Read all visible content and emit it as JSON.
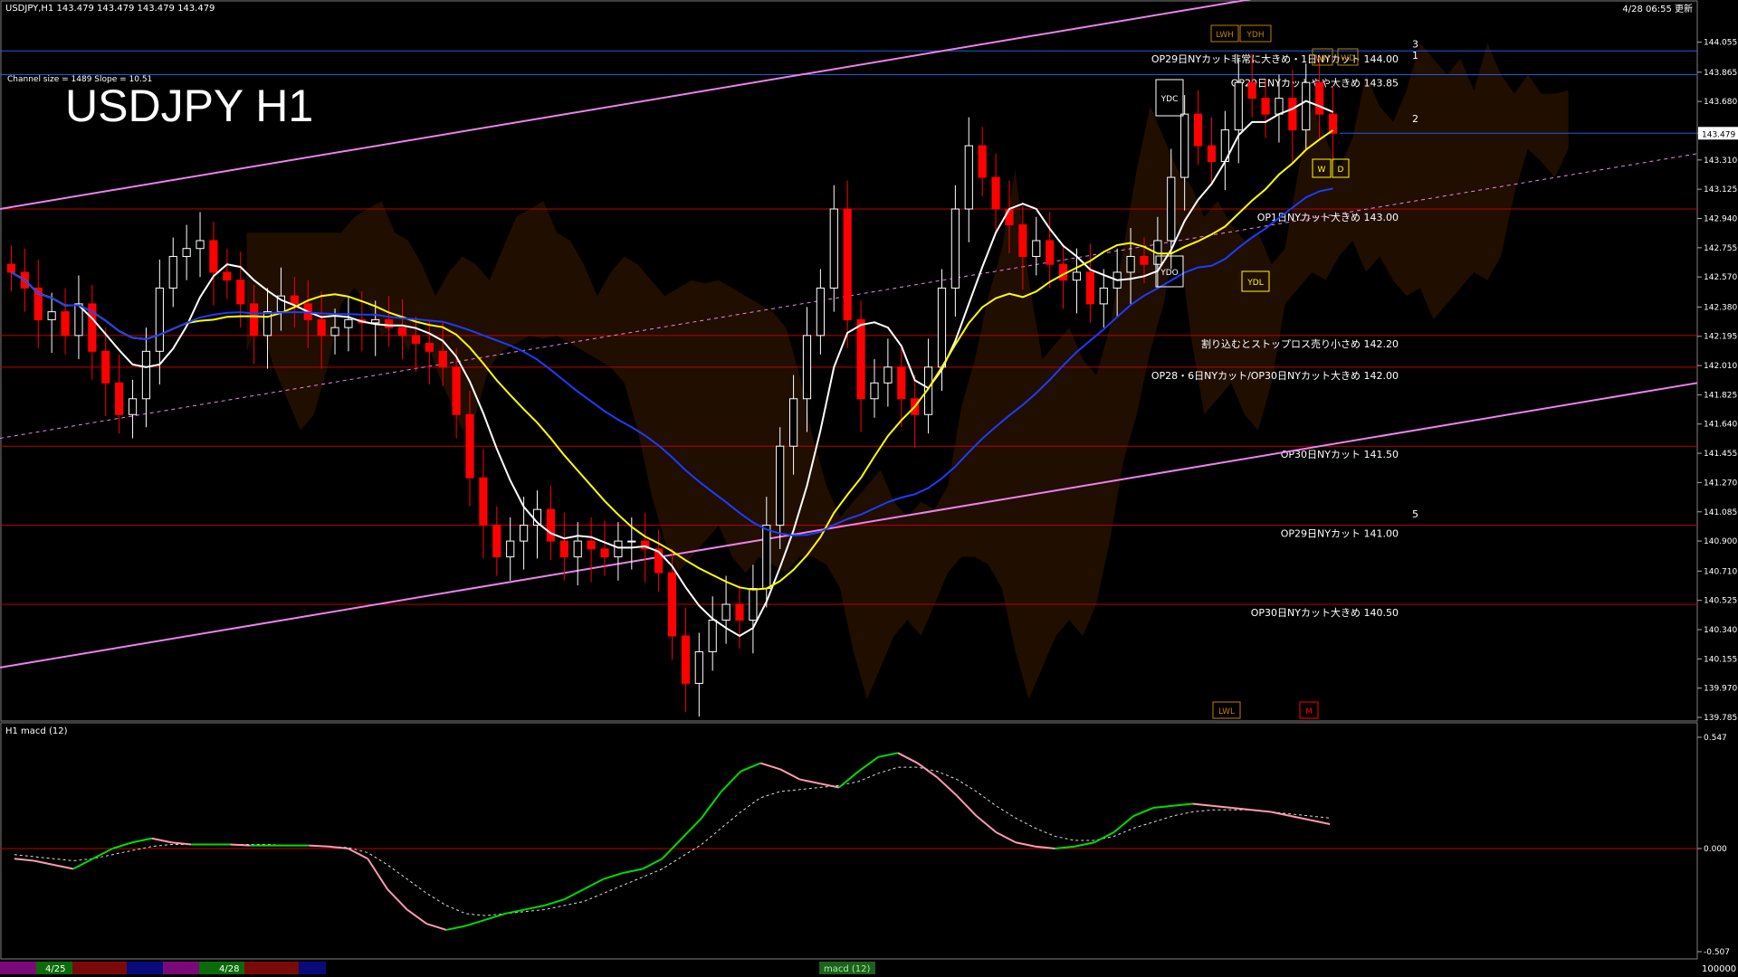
{
  "chart_data": {
    "type": "line",
    "title": "USDJPY H1",
    "header": "USDJPY,H1  143.479 143.479 143.479 143.479",
    "timestamp": "4/28 06:55 更新",
    "channel_info": "Channel size = 1489 Slope = 10.51",
    "current_price": 143.479,
    "ylim": [
      139.785,
      144.15
    ],
    "price_ticks": [
      144.055,
      143.865,
      143.68,
      143.479,
      143.31,
      143.125,
      142.94,
      142.755,
      142.57,
      142.38,
      142.195,
      142.01,
      141.825,
      141.64,
      141.455,
      141.27,
      141.085,
      140.9,
      140.71,
      140.525,
      140.34,
      140.155,
      139.97,
      139.785
    ],
    "levels": [
      {
        "price": 144.0,
        "label": "OP29日NYカット非常に大きめ・1日NYカット 144.00",
        "color": "#1e5fd6"
      },
      {
        "price": 143.85,
        "label": "OP29日NYカットやや大きめ 143.85",
        "color": "#1e5fd6"
      },
      {
        "price": 143.0,
        "label": "OP1日NYカット大きめ 143.00",
        "color": "#c00000"
      },
      {
        "price": 142.2,
        "label": "割り込むとストップロス売り小さめ 142.20",
        "color": "#c00000"
      },
      {
        "price": 142.0,
        "label": "OP28・6日NYカット/OP30日NYカット大きめ 142.00",
        "color": "#c00000"
      },
      {
        "price": 141.5,
        "label": "OP30日NYカット 141.50",
        "color": "#c00000"
      },
      {
        "price": 141.0,
        "label": "OP29日NYカット 141.00",
        "color": "#c00000"
      },
      {
        "price": 140.5,
        "label": "OP30日NYカット大きめ 140.50",
        "color": "#c00000"
      }
    ],
    "channel_line_labels": [
      "3",
      "1",
      "2",
      "5"
    ],
    "box_labels": [
      "YDC",
      "YDO",
      "YDL",
      "LWL",
      "LWH",
      "YDH",
      "WH",
      "WD",
      "W",
      "D",
      "M"
    ],
    "closes": [
      142.6,
      142.5,
      142.3,
      142.35,
      142.2,
      142.4,
      142.1,
      141.9,
      141.7,
      141.8,
      142.1,
      142.5,
      142.7,
      142.75,
      142.8,
      142.6,
      142.55,
      142.4,
      142.2,
      142.35,
      142.45,
      142.4,
      142.3,
      142.2,
      142.25,
      142.3,
      142.28,
      142.3,
      142.25,
      142.2,
      142.15,
      142.1,
      142.0,
      141.7,
      141.3,
      141.0,
      140.8,
      140.9,
      141.0,
      141.1,
      140.9,
      140.8,
      140.9,
      140.85,
      140.8,
      140.9,
      140.9,
      140.85,
      140.7,
      140.3,
      140.0,
      140.2,
      140.4,
      140.5,
      140.4,
      140.6,
      141.0,
      141.5,
      141.8,
      142.2,
      142.5,
      143.0,
      142.3,
      141.8,
      141.9,
      142.0,
      141.8,
      141.7,
      142.0,
      142.5,
      143.0,
      143.4,
      143.2,
      143.0,
      142.9,
      142.7,
      142.8,
      142.65,
      142.55,
      142.6,
      142.4,
      142.5,
      142.6,
      142.7,
      142.65,
      142.8,
      143.2,
      143.6,
      143.4,
      143.3,
      143.5,
      143.8,
      143.7,
      143.6,
      143.7,
      143.5,
      143.8,
      143.6,
      143.479
    ],
    "macd": {
      "title": "H1  macd (12)",
      "ticks": [
        0.547,
        0.0,
        -0.507
      ],
      "ylim": [
        -0.507,
        0.547
      ],
      "main": [
        -0.05,
        -0.06,
        -0.08,
        -0.1,
        -0.05,
        0.0,
        0.03,
        0.05,
        0.03,
        0.02,
        0.02,
        0.02,
        0.015,
        0.015,
        0.015,
        0.015,
        0.01,
        0.0,
        -0.05,
        -0.2,
        -0.3,
        -0.37,
        -0.4,
        -0.38,
        -0.35,
        -0.32,
        -0.3,
        -0.28,
        -0.25,
        -0.2,
        -0.15,
        -0.12,
        -0.1,
        -0.05,
        0.05,
        0.15,
        0.28,
        0.38,
        0.42,
        0.39,
        0.34,
        0.32,
        0.3,
        0.38,
        0.45,
        0.47,
        0.42,
        0.35,
        0.26,
        0.16,
        0.08,
        0.03,
        0.01,
        0.0,
        0.01,
        0.03,
        0.08,
        0.16,
        0.2,
        0.21,
        0.22,
        0.21,
        0.2,
        0.19,
        0.18,
        0.16,
        0.14,
        0.12
      ],
      "signal": [
        -0.03,
        -0.04,
        -0.05,
        -0.06,
        -0.05,
        -0.03,
        -0.01,
        0.01,
        0.02,
        0.02,
        0.02,
        0.02,
        0.02,
        0.02,
        0.015,
        0.015,
        0.01,
        0.005,
        -0.02,
        -0.08,
        -0.15,
        -0.22,
        -0.28,
        -0.32,
        -0.33,
        -0.32,
        -0.31,
        -0.3,
        -0.28,
        -0.26,
        -0.22,
        -0.18,
        -0.14,
        -0.1,
        -0.04,
        0.02,
        0.1,
        0.18,
        0.25,
        0.28,
        0.29,
        0.3,
        0.31,
        0.33,
        0.37,
        0.4,
        0.4,
        0.38,
        0.34,
        0.28,
        0.21,
        0.15,
        0.1,
        0.06,
        0.04,
        0.04,
        0.06,
        0.1,
        0.13,
        0.16,
        0.18,
        0.19,
        0.19,
        0.19,
        0.18,
        0.17,
        0.16,
        0.15
      ]
    },
    "bottom_bar": {
      "dates": [
        "4/25",
        "4/28"
      ],
      "status": "macd (12)",
      "right": "100000"
    },
    "colors": {
      "bg": "#000000",
      "bull": "#ffffff",
      "bear": "#ff0000",
      "ma_fast": "#ffffff",
      "ma_mid": "#ffff00",
      "ma_slow": "#1e3cff",
      "channel": "#ee82ee",
      "macd_up": "#00dd00",
      "macd_down": "#ff9ab0"
    }
  }
}
